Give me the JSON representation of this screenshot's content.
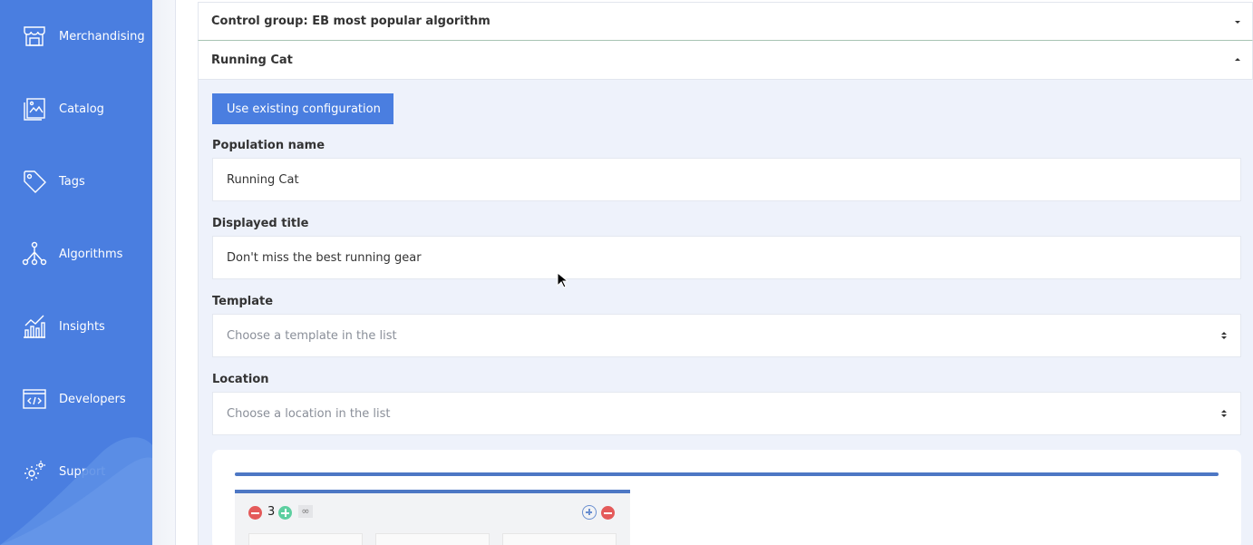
{
  "sidebar": {
    "items": [
      {
        "label": "Merchandising",
        "icon": "storefront-icon"
      },
      {
        "label": "Catalog",
        "icon": "catalog-icon"
      },
      {
        "label": "Tags",
        "icon": "tag-icon"
      },
      {
        "label": "Algorithms",
        "icon": "algorithm-tree-icon"
      },
      {
        "label": "Insights",
        "icon": "insights-chart-icon"
      },
      {
        "label": "Developers",
        "icon": "code-icon"
      },
      {
        "label": "Support",
        "icon": "gear-icon"
      }
    ]
  },
  "accordion": {
    "control_group": "Control group: EB most popular algorithm",
    "running_cat": "Running Cat"
  },
  "form": {
    "use_existing_button": "Use existing configuration",
    "population_name_label": "Population name",
    "population_name_value": "Running Cat",
    "displayed_title_label": "Displayed title",
    "displayed_title_value": "Don't miss the best running gear",
    "template_label": "Template",
    "template_placeholder": "Choose a template in the list",
    "location_label": "Location",
    "location_placeholder": "Choose a location in the list"
  },
  "preview": {
    "count": "3",
    "infinity": "∞"
  },
  "colors": {
    "sidebar": "#4a7ee0",
    "primary_button": "#4a7ee0",
    "panel_bg": "#eef2fb",
    "accent_bar": "#4d77c4",
    "minus": "#e45a5a",
    "plus": "#5dcfa0"
  }
}
